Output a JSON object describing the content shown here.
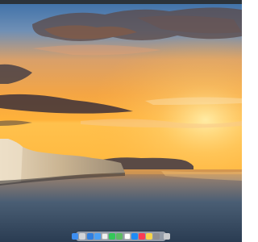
{
  "screen": {
    "wallpaper_name": "sunset-white-cliffs-over-sea",
    "colors": {
      "sky_top": "#3a6ea5",
      "sky_mid": "#f2a24a",
      "horizon": "#ffb640",
      "sea": "#2d4a66",
      "cliff": "#d9c7a8"
    }
  },
  "menubar": {
    "present": true
  },
  "dock": {
    "apps": [
      {
        "icon": "finder-icon",
        "color": "#3d8ef0"
      },
      {
        "icon": "launchpad-icon",
        "color": "#d0d3d8"
      },
      {
        "icon": "safari-icon",
        "color": "#2f7fe0"
      },
      {
        "icon": "mail-icon",
        "color": "#4aa0f5"
      },
      {
        "icon": "photos-icon",
        "color": "#f0f0f0"
      },
      {
        "icon": "messages-icon",
        "color": "#34c759"
      },
      {
        "icon": "maps-icon",
        "color": "#5dbb63"
      },
      {
        "icon": "calendar-icon",
        "color": "#ffffff"
      },
      {
        "icon": "app-store-icon",
        "color": "#1f8cf5"
      },
      {
        "icon": "music-icon",
        "color": "#fa3c55"
      },
      {
        "icon": "notes-icon",
        "color": "#f7d54a"
      },
      {
        "icon": "system-settings-icon",
        "color": "#8e8e93"
      },
      {
        "icon": "trash-icon",
        "color": "#c7c9cd"
      }
    ]
  }
}
